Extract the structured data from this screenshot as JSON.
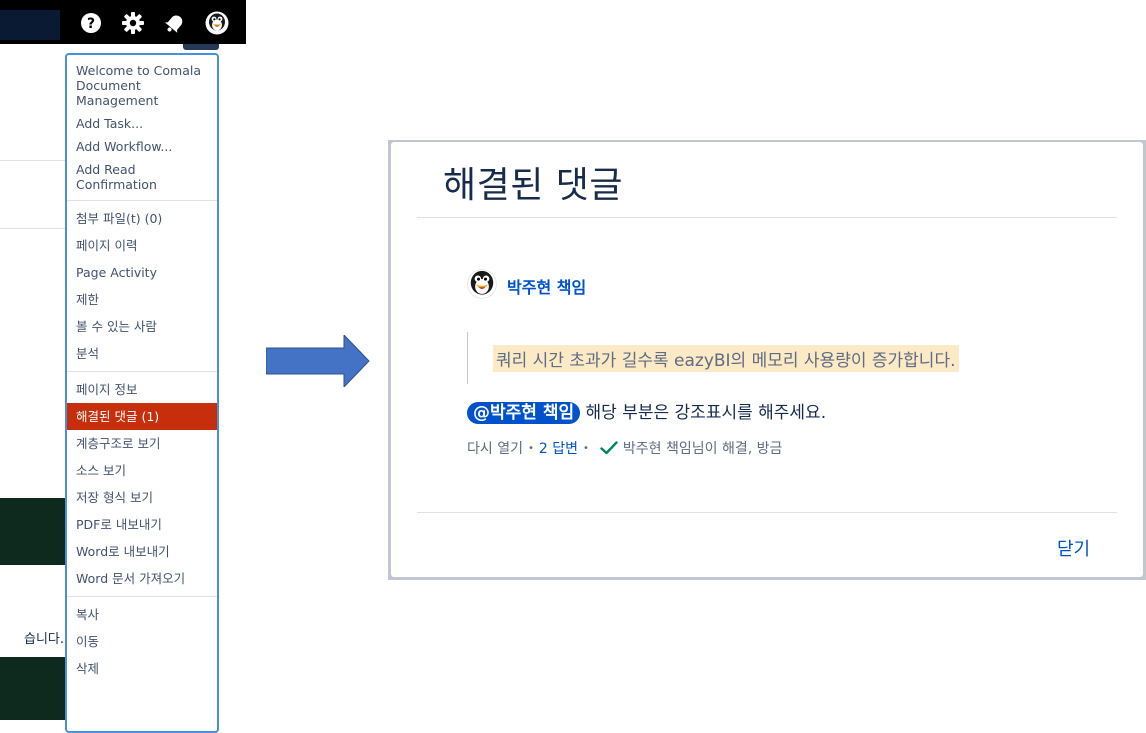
{
  "topbar": {
    "icons": [
      "help-icon",
      "settings-icon",
      "notifications-icon",
      "user-avatar-icon"
    ]
  },
  "background": {
    "text_fragment": "습니다."
  },
  "menu": {
    "sections": [
      {
        "items": [
          {
            "label": "Welcome to Comala Document Management"
          },
          {
            "label": "Add Task..."
          },
          {
            "label": "Add Workflow..."
          },
          {
            "label": "Add Read Confirmation"
          }
        ]
      },
      {
        "items": [
          {
            "label": "첨부 파일(t) (0)"
          },
          {
            "label": "페이지 이력"
          },
          {
            "label": "Page Activity"
          },
          {
            "label": "제한"
          },
          {
            "label": "볼 수 있는 사람"
          },
          {
            "label": "분석"
          }
        ]
      },
      {
        "items": [
          {
            "label": "페이지 정보"
          },
          {
            "label": "해결된 댓글 (1)",
            "active": true
          },
          {
            "label": "계층구조로 보기"
          },
          {
            "label": "소스 보기"
          },
          {
            "label": "저장 형식 보기"
          },
          {
            "label": "PDF로 내보내기"
          },
          {
            "label": "Word로 내보내기"
          },
          {
            "label": "Word 문서 가져오기"
          }
        ]
      },
      {
        "items": [
          {
            "label": "복사"
          },
          {
            "label": "이동"
          },
          {
            "label": "삭제"
          }
        ]
      }
    ]
  },
  "dialog": {
    "title": "해결된 댓글",
    "author": "박주현 책임",
    "quoted_text": "쿼리 시간 초과가 길수록 eazyBI의 메모리 사용량이 증가합니다.",
    "mention": "@박주현 책임",
    "comment_text": "해당 부분은 강조표시를 해주세요.",
    "reopen_label": "다시 열기",
    "replies_label": "2 답변",
    "resolved_text": "박주현 책임님이 해결, 방금",
    "close_label": "닫기"
  },
  "colors": {
    "menu_active_bg": "#c72e0c",
    "menu_border": "#4a90d9",
    "link": "#0052cc",
    "highlight": "#fce9c5",
    "arrow": "#4472c4",
    "resolved_check": "#00875a"
  }
}
